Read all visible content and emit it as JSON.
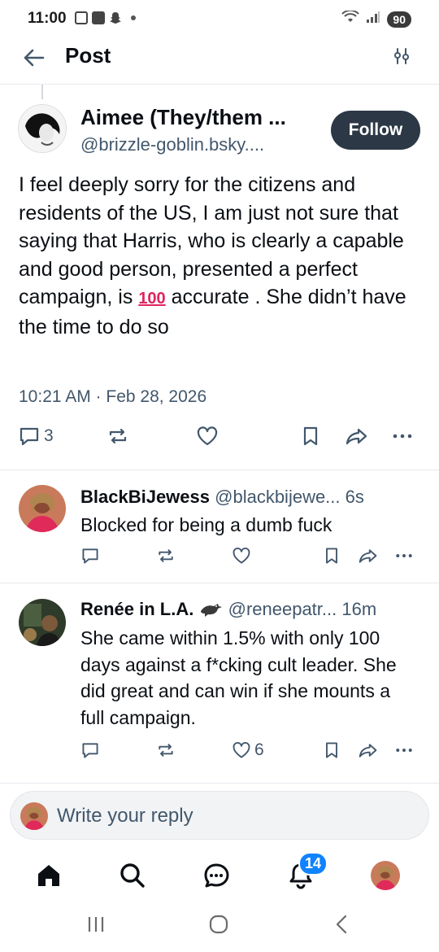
{
  "status_bar": {
    "time": "11:00",
    "battery": "90"
  },
  "header": {
    "title": "Post"
  },
  "post": {
    "author_name": "Aimee (They/them ...",
    "author_handle": "@brizzle-goblin.bsky....",
    "follow_label": "Follow",
    "body_before": "I feel deeply sorry for the citizens and residents of the US, I am just not sure that saying that Harris, who is clearly a capable and good person, presented a perfect campaign, is",
    "emoji": "100",
    "body_after": "accurate . She didn’t have the time to do so",
    "timestamp": "10:21 AM · Feb 28, 2026",
    "reply_count": "3"
  },
  "replies": [
    {
      "name": "BlackBiJewess",
      "meta": "@blackbijewe... 6s",
      "text": "Blocked for being a dumb fuck",
      "like_count": ""
    },
    {
      "name": "Renée in L.A.",
      "meta": "@reneepatr... 16m",
      "text": "She came within 1.5% with only 100 days against a f*cking cult leader. She did great and can win if she mounts a full campaign.",
      "like_count": "6"
    }
  ],
  "composer": {
    "placeholder": "Write your reply"
  },
  "bottom_nav": {
    "notifications_badge": "14"
  },
  "colors": {
    "accent": "#1083fe",
    "follow_bg": "#2c3845",
    "muted": "#42576c",
    "badge": "#1083fe"
  }
}
